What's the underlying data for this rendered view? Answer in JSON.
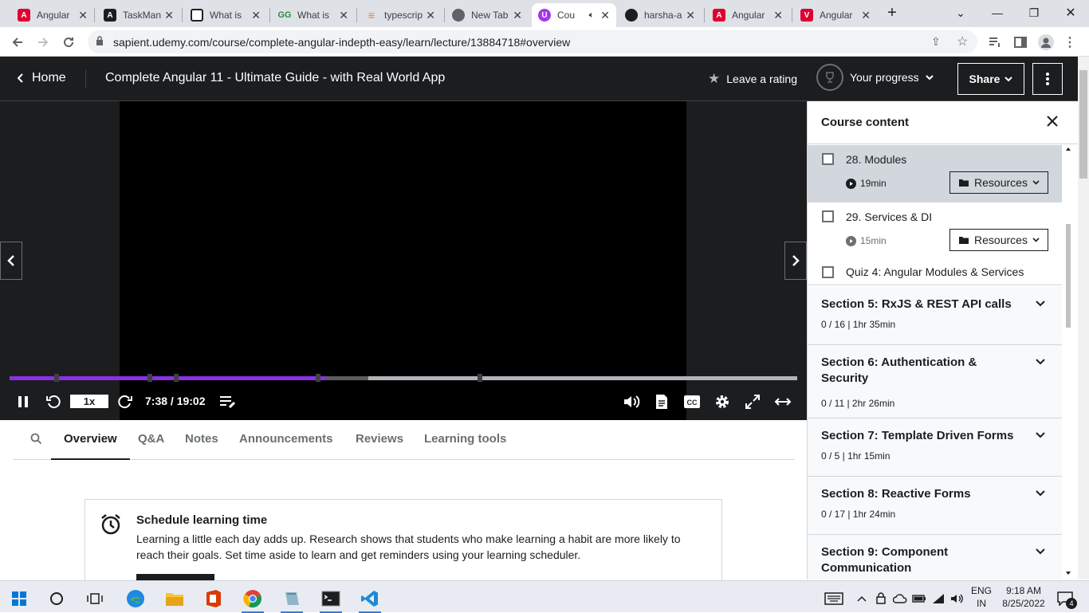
{
  "browser": {
    "tabs": [
      {
        "title": "Angular",
        "favicon": "angular-icon",
        "color": "#dd0031"
      },
      {
        "title": "TaskMan",
        "favicon": "angular-icon",
        "color": "#1c1d1f"
      },
      {
        "title": "What is",
        "favicon": "window-icon",
        "color": "#202124"
      },
      {
        "title": "What is",
        "favicon": "geeksforgeeks-icon",
        "color": "#2f8d46"
      },
      {
        "title": "typescrip",
        "favicon": "stackoverflow-icon",
        "color": "#f48024"
      },
      {
        "title": "New Tab",
        "favicon": "chrome-icon",
        "color": "#5f6368"
      },
      {
        "title": "Cou",
        "favicon": "udemy-icon",
        "color": "#a435f0",
        "active": true
      },
      {
        "title": "harsha-a",
        "favicon": "github-icon",
        "color": "#1c1d1f"
      },
      {
        "title": "Angular",
        "favicon": "angular-icon",
        "color": "#dd0031"
      },
      {
        "title": "Angular",
        "favicon": "angular-icon",
        "color": "#dd0031"
      }
    ],
    "url": "sapient.udemy.com/course/complete-angular-indepth-easy/learn/lecture/13884718#overview"
  },
  "header": {
    "home_label": "Home",
    "course_title": "Complete Angular 11 - Ultimate Guide - with Real World App",
    "rating_label": "Leave a rating",
    "progress_label": "Your progress",
    "share_label": "Share"
  },
  "player": {
    "speed": "1x",
    "time": "7:38 / 19:02",
    "played_fraction": 0.401,
    "buffered_fraction": 0.455
  },
  "lecture_tabs": [
    "Overview",
    "Q&A",
    "Notes",
    "Announcements",
    "Reviews",
    "Learning tools"
  ],
  "schedule": {
    "title": "Schedule learning time",
    "description": "Learning a little each day adds up. Research shows that students who make learning a habit are more likely to reach their goals. Set time aside to learn and get reminders using your learning scheduler."
  },
  "sidebar": {
    "title": "Course content",
    "lectures": [
      {
        "title": "28. Modules",
        "duration": "19min",
        "resources": "Resources",
        "current": true
      },
      {
        "title": "29. Services & DI",
        "duration": "15min",
        "resources": "Resources",
        "current": false
      }
    ],
    "quiz": "Quiz 4: Angular Modules & Services",
    "sections": [
      {
        "title": "Section 5: RxJS & REST API calls",
        "meta": "0 / 16 | 1hr 35min"
      },
      {
        "title": "Section 6: Authentication & Security",
        "meta": "0 / 11 | 2hr 26min"
      },
      {
        "title": "Section 7: Template Driven Forms",
        "meta": "0 / 5 | 1hr 15min"
      },
      {
        "title": "Section 8: Reactive Forms",
        "meta": "0 / 17 | 1hr 24min"
      },
      {
        "title": "Section 9: Component Communication",
        "meta": ""
      }
    ]
  },
  "taskbar": {
    "lang1": "ENG",
    "lang2": "IN",
    "time": "9:18 AM",
    "date": "8/25/2022",
    "notifications": "4"
  },
  "colors": {
    "accent": "#a435f0",
    "progress": "#8b31e4",
    "dark": "#1c1d1f"
  }
}
